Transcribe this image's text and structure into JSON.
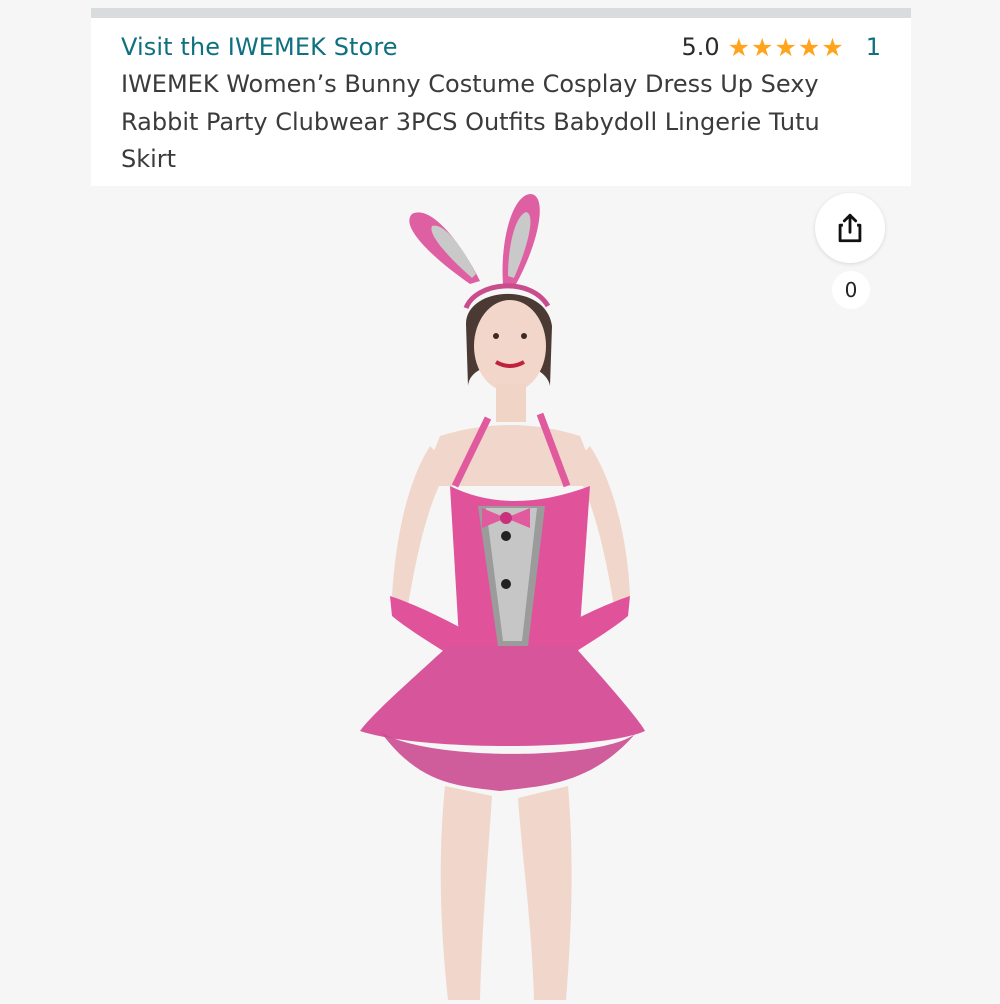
{
  "header": {
    "store_link": "Visit the IWEMEK Store",
    "rating_value": "5.0",
    "rating_stars": 5,
    "rating_count": "1",
    "product_title": "IWEMEK Women’s Bunny Costume Cosplay Dress Up Sexy Rabbit Party Clubwear 3PCS Outfits Babydoll Lingerie Tutu Skirt"
  },
  "gallery": {
    "share_icon": "share-icon",
    "share_count": "0"
  },
  "colors": {
    "link": "#0e7080",
    "star": "#ffa41c",
    "costume_pink": "#e0539a",
    "background": "#f6f6f6"
  }
}
